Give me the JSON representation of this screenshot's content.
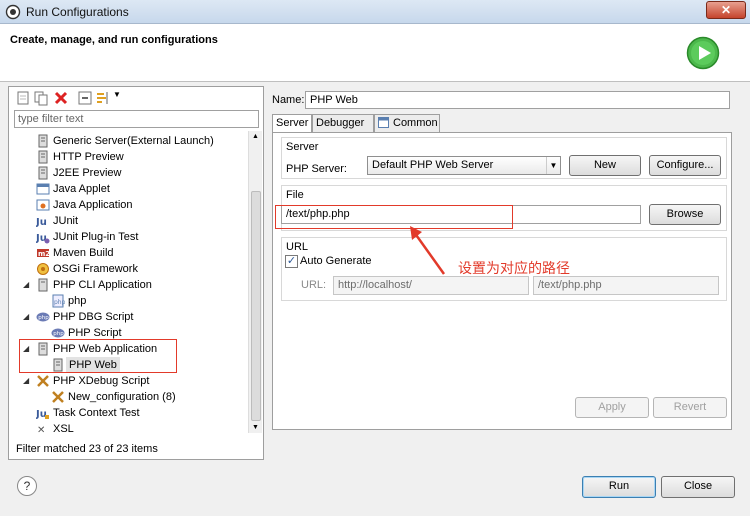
{
  "window": {
    "title": "Run Configurations",
    "close_glyph": "✕"
  },
  "header": {
    "title": "Create, manage, and run configurations",
    "run_icon": "run-icon",
    "accent": "#3aa53a"
  },
  "left": {
    "toolbar_icons": [
      "new-config-icon",
      "duplicate-icon",
      "delete-icon",
      "collapse-all-icon",
      "filter-icon"
    ],
    "filter_placeholder": "type filter text",
    "tree": [
      {
        "label": "Generic Server(External Launch)",
        "icon": "server-icon",
        "level": 0
      },
      {
        "label": "HTTP Preview",
        "icon": "server-icon",
        "level": 0
      },
      {
        "label": "J2EE Preview",
        "icon": "server-icon",
        "level": 0
      },
      {
        "label": "Java Applet",
        "icon": "applet-icon",
        "level": 0
      },
      {
        "label": "Java Application",
        "icon": "java-app-icon",
        "level": 0
      },
      {
        "label": "JUnit",
        "icon": "junit-icon",
        "level": 0
      },
      {
        "label": "JUnit Plug-in Test",
        "icon": "junit-plugin-icon",
        "level": 0
      },
      {
        "label": "Maven Build",
        "icon": "maven-icon",
        "level": 0
      },
      {
        "label": "OSGi Framework",
        "icon": "osgi-icon",
        "level": 0
      },
      {
        "label": "PHP CLI Application",
        "icon": "php-cli-icon",
        "level": 0,
        "expanded": true
      },
      {
        "label": "php",
        "icon": "php-file-icon",
        "level": 1
      },
      {
        "label": "PHP DBG Script",
        "icon": "php-dbg-icon",
        "level": 0,
        "expanded": true
      },
      {
        "label": "PHP Script",
        "icon": "php-dbg-icon",
        "level": 1
      },
      {
        "label": "PHP Web Application",
        "icon": "php-web-icon",
        "level": 0,
        "expanded": true
      },
      {
        "label": "PHP Web",
        "icon": "php-web-icon",
        "level": 1,
        "selected": true
      },
      {
        "label": "PHP XDebug Script",
        "icon": "xdebug-icon",
        "level": 0,
        "expanded": true
      },
      {
        "label": "New_configuration (8)",
        "icon": "xdebug-icon",
        "level": 1
      },
      {
        "label": "Task Context Test",
        "icon": "task-test-icon",
        "level": 0
      },
      {
        "label": "XSL",
        "icon": "xsl-icon",
        "level": 0
      }
    ],
    "filter_status": "Filter matched 23 of 23 items"
  },
  "right": {
    "name_label": "Name:",
    "name_value": "PHP Web",
    "tabs": [
      {
        "label": "Server",
        "active": true
      },
      {
        "label": "Debugger",
        "active": false
      },
      {
        "label": "Common",
        "active": false
      }
    ],
    "server_group": {
      "title": "Server",
      "php_server_label": "PHP Server:",
      "php_server_value": "Default PHP Web Server",
      "new_button": "New",
      "configure_button": "Configure..."
    },
    "file_group": {
      "title": "File",
      "file_value": "/text/php.php",
      "browse_button": "Browse"
    },
    "url_group": {
      "title": "URL",
      "auto_generate_label": "Auto Generate",
      "auto_generate_checked": true,
      "url_label": "URL:",
      "url_base": "http://localhost/",
      "url_path": "/text/php.php"
    },
    "apply_button": "Apply",
    "revert_button": "Revert"
  },
  "annotation": {
    "text": "设置为对应的路径",
    "color": "#e23a2a"
  },
  "footer": {
    "help_glyph": "?",
    "run_button": "Run",
    "close_button": "Close"
  }
}
